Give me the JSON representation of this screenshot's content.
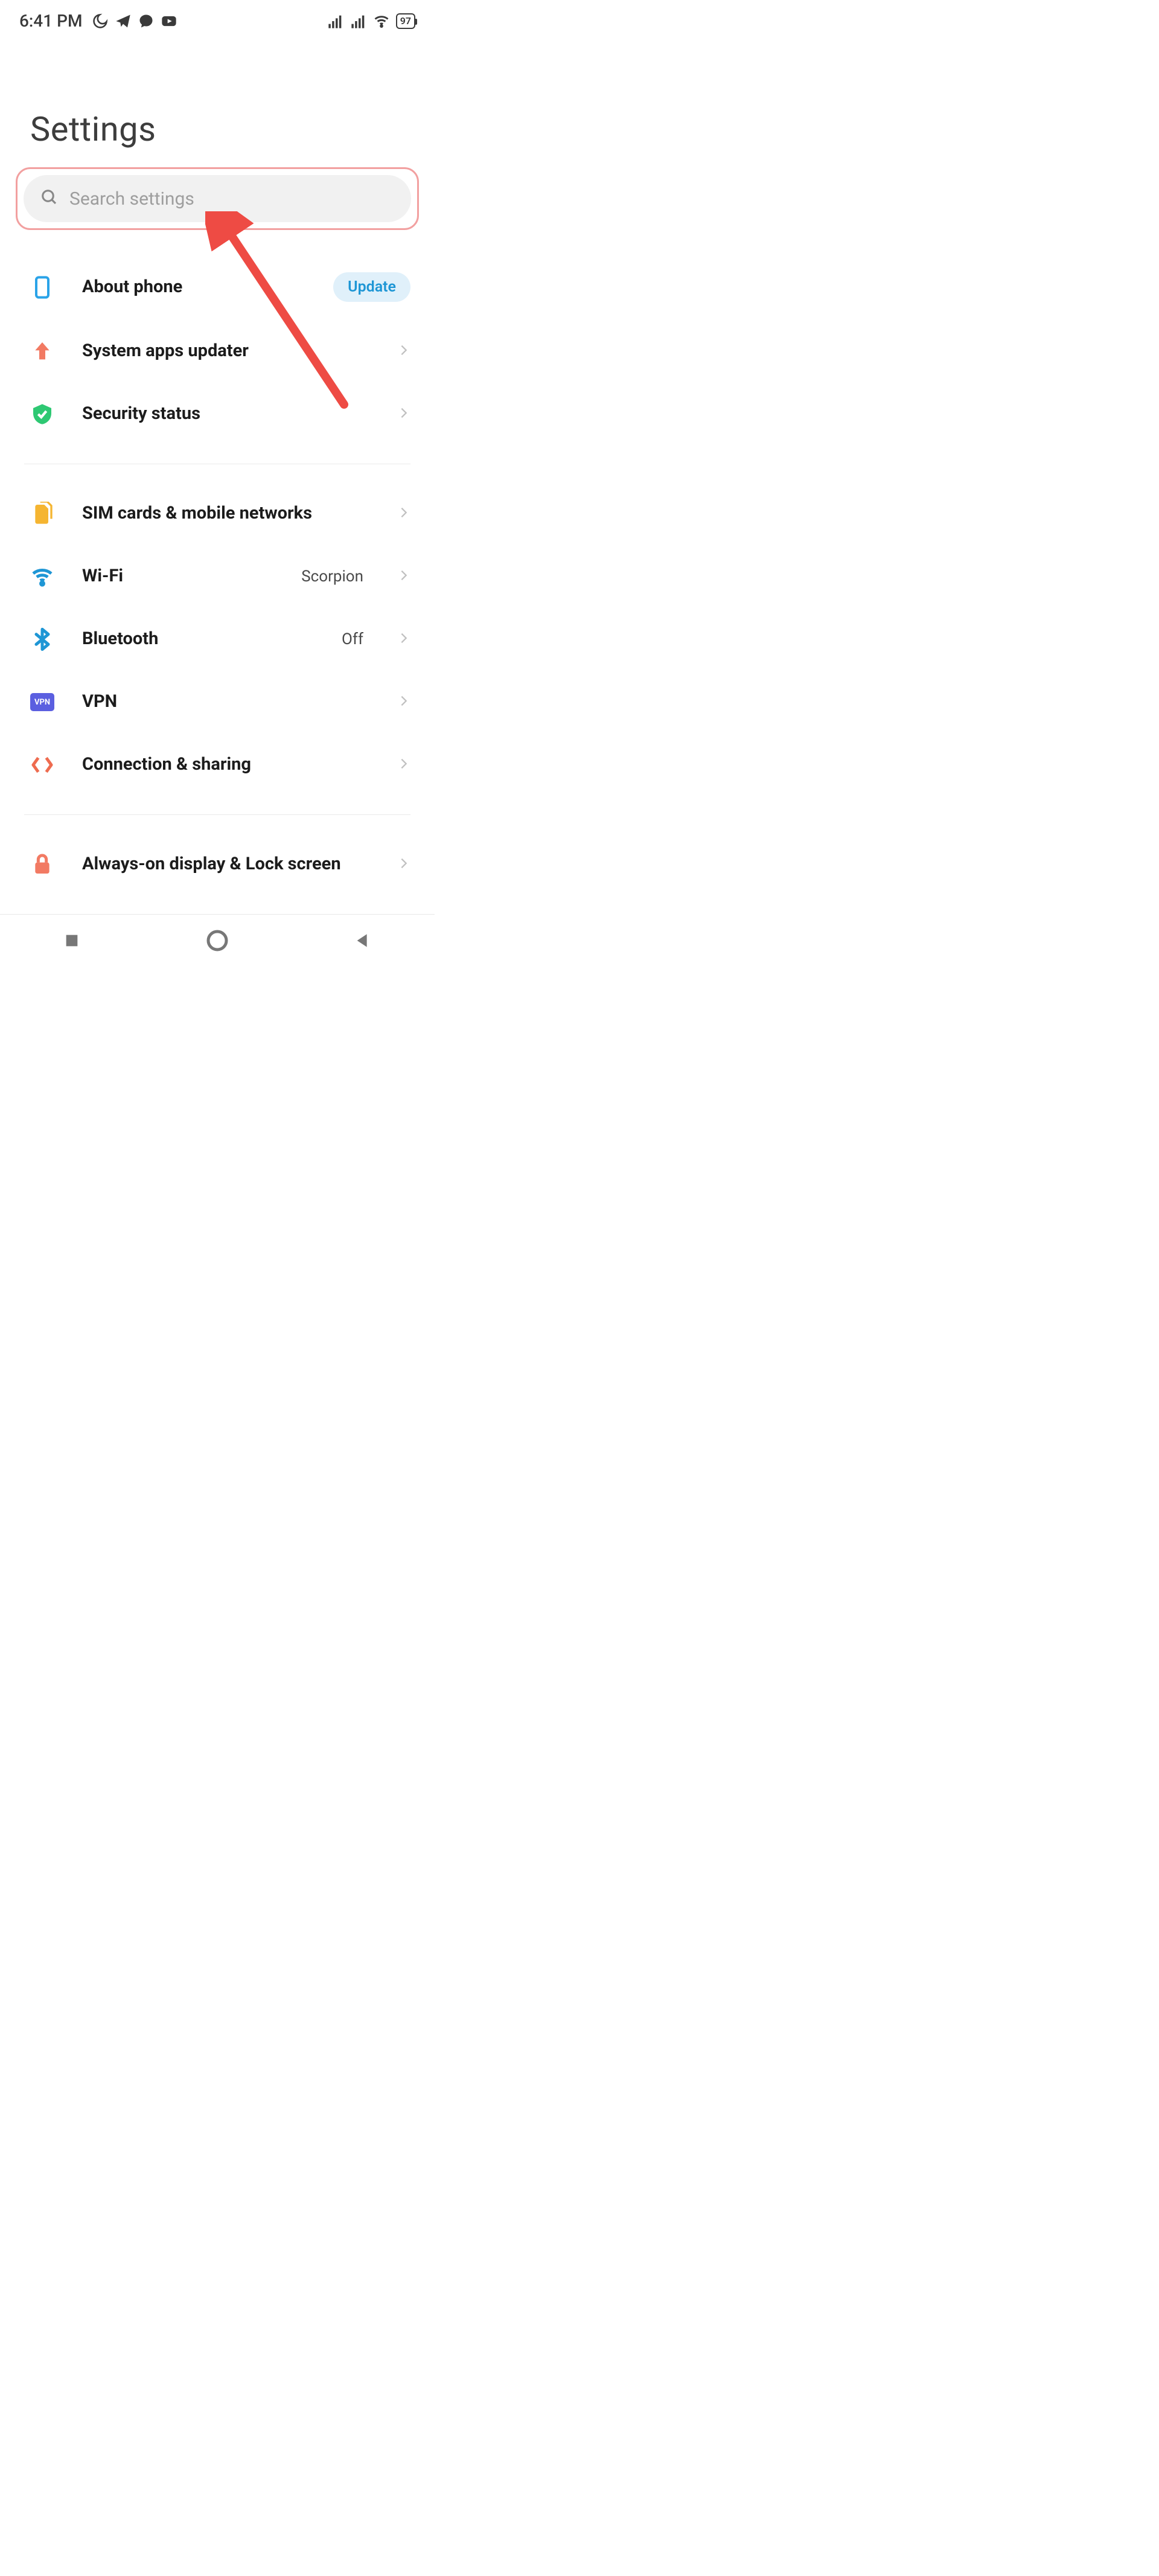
{
  "status": {
    "time": "6:41 PM",
    "battery": "97"
  },
  "page_title": "Settings",
  "search": {
    "placeholder": "Search settings"
  },
  "group1": {
    "about": {
      "label": "About phone",
      "badge": "Update"
    },
    "updater": {
      "label": "System apps updater"
    },
    "security": {
      "label": "Security status"
    }
  },
  "group2": {
    "sim": {
      "label": "SIM cards & mobile networks"
    },
    "wifi": {
      "label": "Wi-Fi",
      "value": "Scorpion"
    },
    "bt": {
      "label": "Bluetooth",
      "value": "Off"
    },
    "vpn": {
      "label": "VPN"
    },
    "conn": {
      "label": "Connection & sharing"
    }
  },
  "group3": {
    "aod": {
      "label": "Always-on display & Lock screen"
    }
  },
  "vpn_icon_text": "VPN"
}
